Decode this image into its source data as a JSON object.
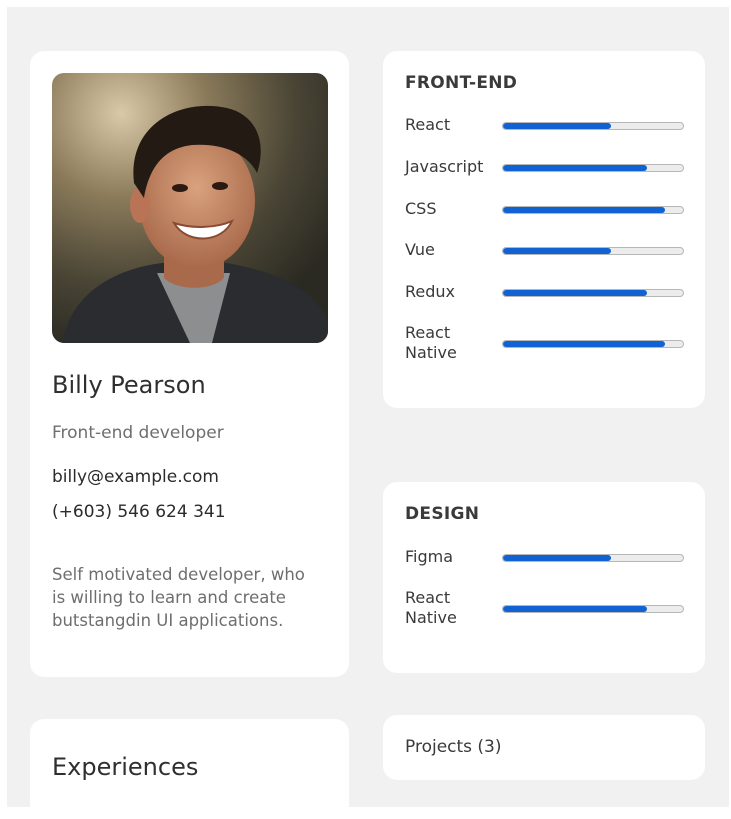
{
  "profile": {
    "name": "Billy Pearson",
    "role": "Front-end developer",
    "email": "billy@example.com",
    "phone": "(+603) 546 624 341",
    "bio": "Self motivated developer, who is willing to learn and create butstangdin UI applications."
  },
  "frontend": {
    "title": "FRONT-END",
    "skills": [
      {
        "label": "React",
        "level": 0.6
      },
      {
        "label": "Javascript",
        "level": 0.8
      },
      {
        "label": "CSS",
        "level": 0.9
      },
      {
        "label": "Vue",
        "level": 0.6
      },
      {
        "label": "Redux",
        "level": 0.8
      },
      {
        "label": "React Native",
        "level": 0.9
      }
    ]
  },
  "design": {
    "title": "DESIGN",
    "skills": [
      {
        "label": "Figma",
        "level": 0.6
      },
      {
        "label": "React Native",
        "level": 0.8
      }
    ]
  },
  "experiences": {
    "title": "Experiences"
  },
  "projects": {
    "title": "Projects (3)"
  },
  "colors": {
    "accent": "#1163d3",
    "background": "#f1f1f1",
    "card": "#ffffff"
  }
}
